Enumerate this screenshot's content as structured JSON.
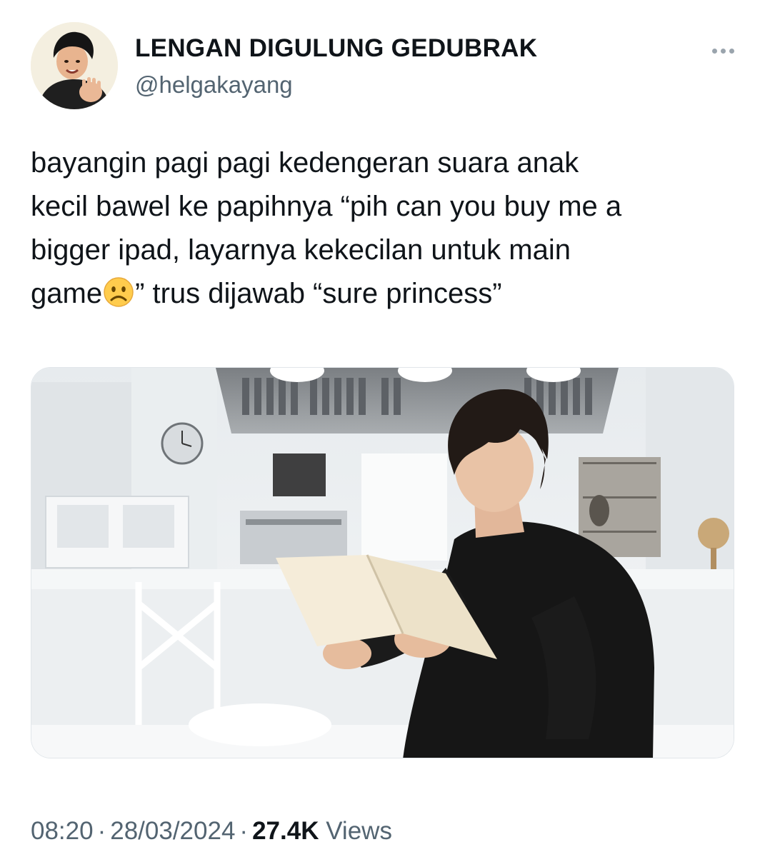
{
  "author": {
    "display_name": "LENGAN DIGULUNG GEDUBRAK",
    "handle": "@helgakayang",
    "avatar_icon": "avatar-photo"
  },
  "tweet": {
    "lines": [
      "bayangin pagi pagi kedengeran suara anak",
      "kecil bawel ke papihnya “pih can you buy me a",
      "bigger ipad, layarnya kekecilan untuk main"
    ],
    "last_line_before_emoji": "game",
    "emoji": "☹️",
    "last_line_after_emoji": "” trus dijawab “sure princess”"
  },
  "media": {
    "type": "photo",
    "description_icon": "attached-photo"
  },
  "meta": {
    "time": "08:20",
    "separator": "·",
    "date": "28/03/2024",
    "views_count": "27.4K",
    "views_label": "Views"
  },
  "colors": {
    "text_primary": "#0f1419",
    "text_secondary": "#536471"
  }
}
